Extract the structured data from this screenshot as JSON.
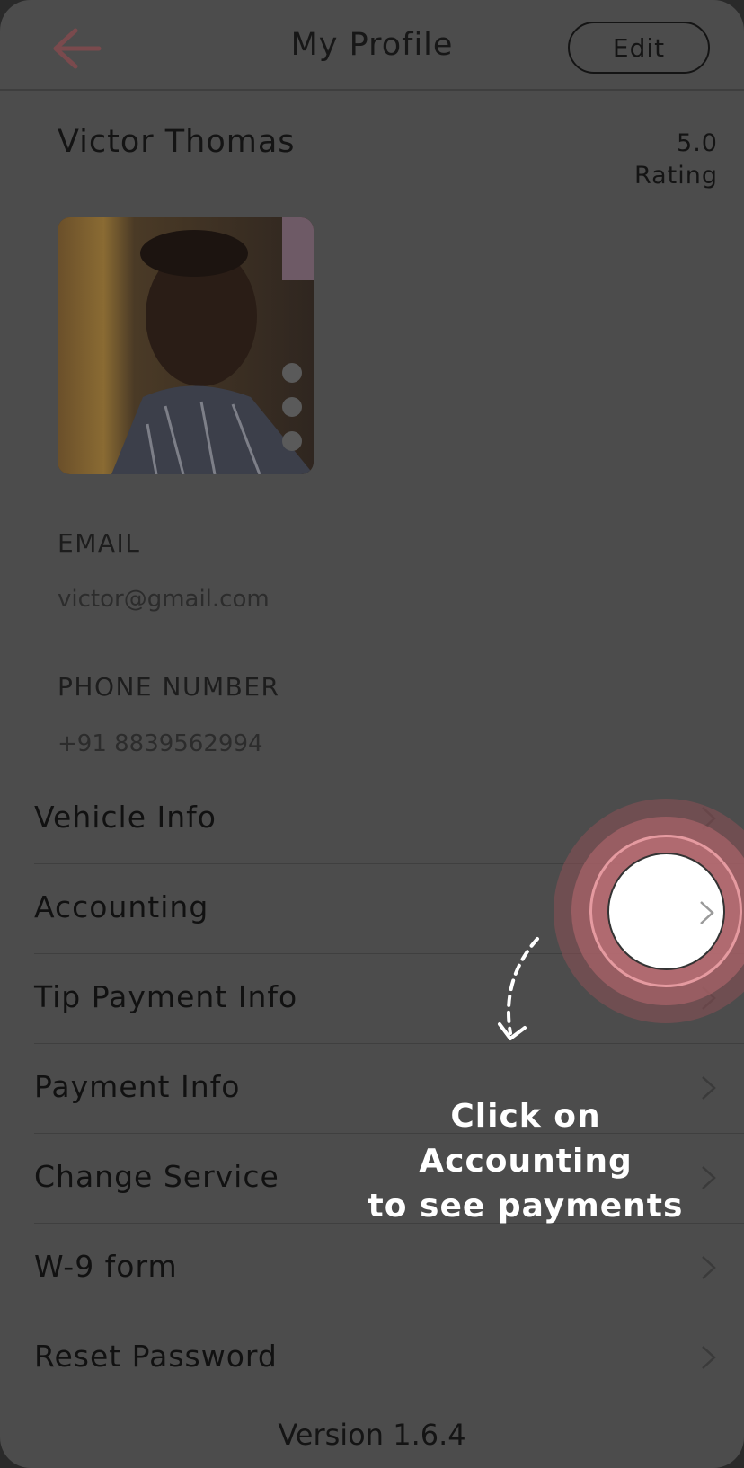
{
  "header": {
    "title": "My Profile",
    "edit_label": "Edit",
    "back_icon": "arrow-left-icon"
  },
  "profile": {
    "name": "Victor Thomas",
    "rating_value": "5.0",
    "rating_label": "Rating",
    "email_label": "EMAIL",
    "email_value": "victor@gmail.com",
    "phone_label": "PHONE NUMBER",
    "phone_value": "+91 8839562994"
  },
  "menu": [
    {
      "label": "Vehicle Info"
    },
    {
      "label": "Accounting"
    },
    {
      "label": "Tip Payment Info"
    },
    {
      "label": "Payment Info"
    },
    {
      "label": "Change Service"
    },
    {
      "label": "W-9 form"
    },
    {
      "label": "Reset Password"
    }
  ],
  "version": "Version 1.6.4",
  "tutorial": {
    "line1": "Click on Accounting",
    "line2": "to see payments"
  },
  "colors": {
    "overlay": "#4c4c4c",
    "accent": "#8a4b4f",
    "highlight_ring": "#e59aa0"
  }
}
